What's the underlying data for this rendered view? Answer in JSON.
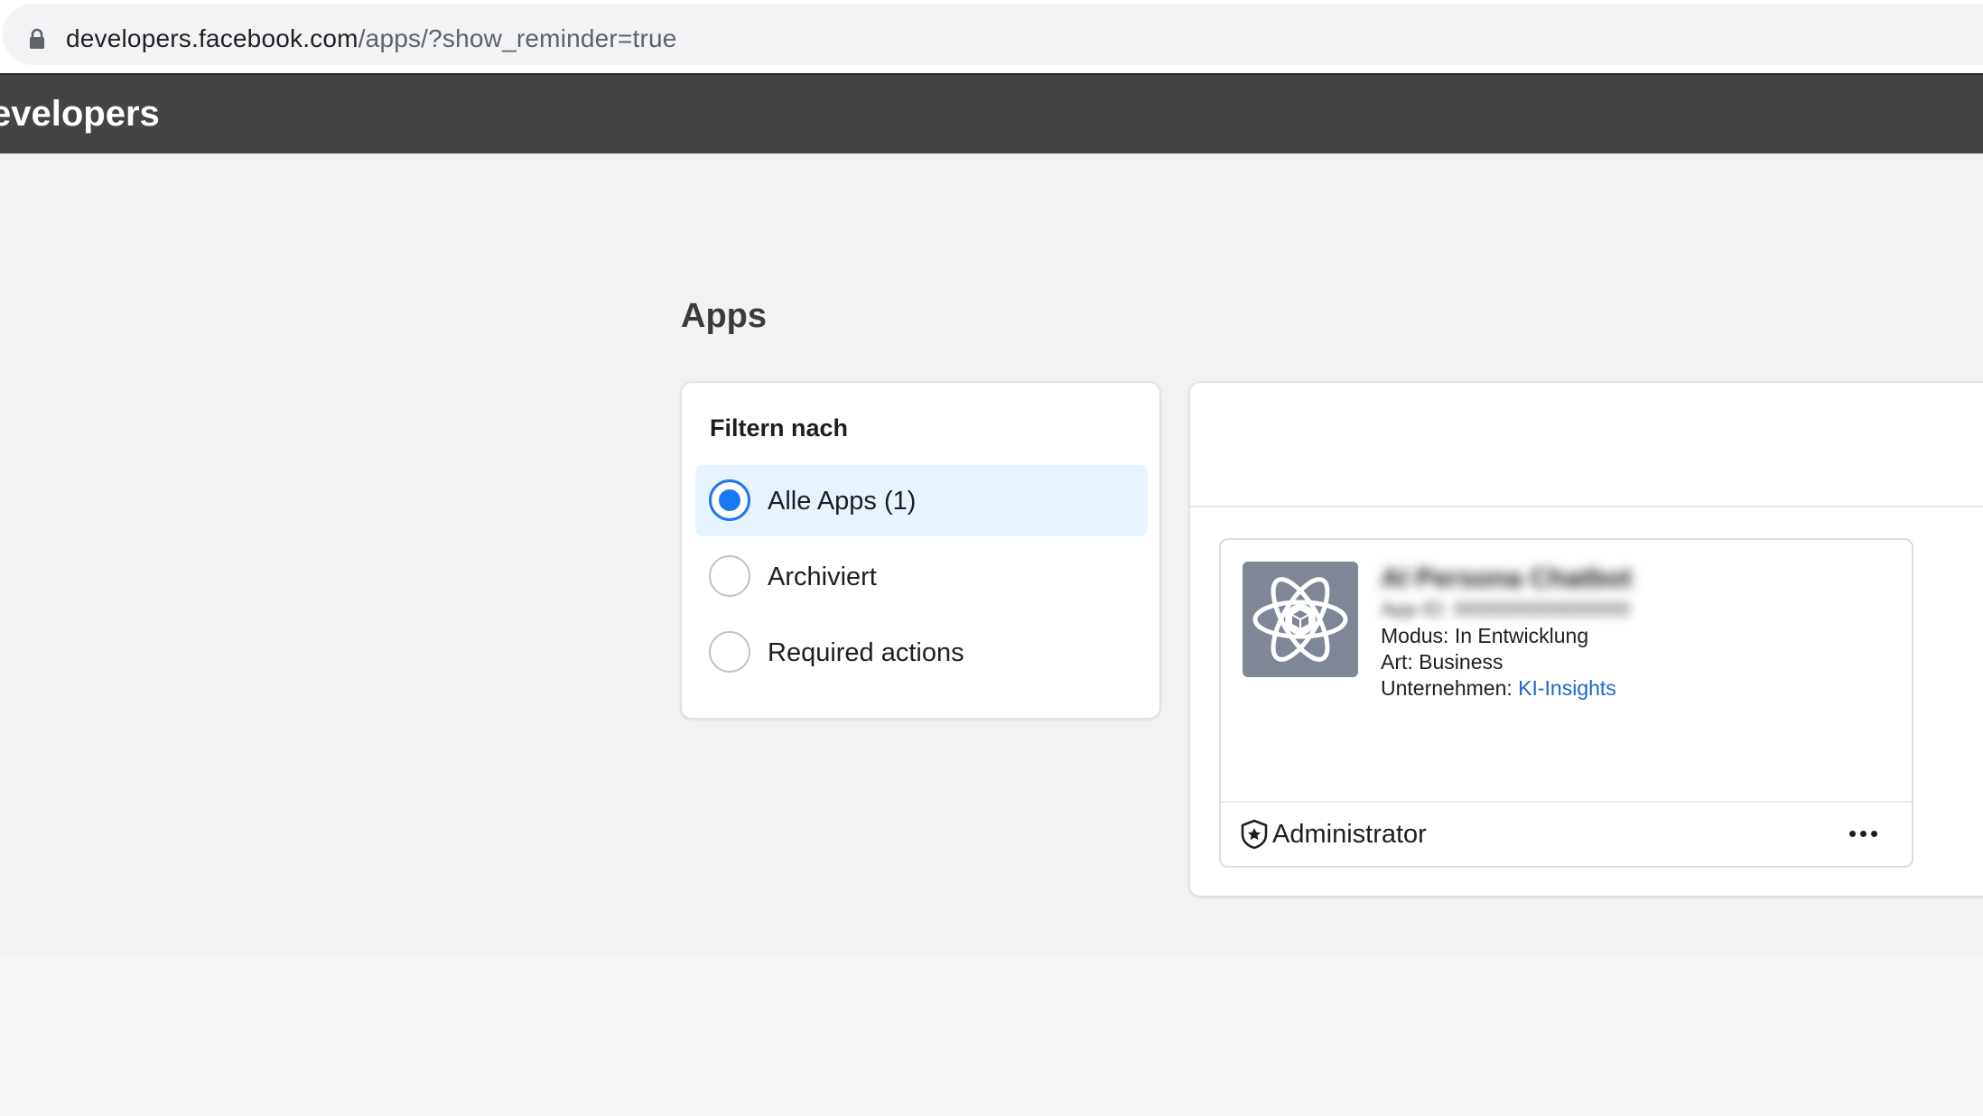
{
  "browser": {
    "url_host": "developers.facebook.com",
    "url_path": "/apps/?show_reminder=true",
    "lock_icon": "lock-icon"
  },
  "header": {
    "brand": "evelopers"
  },
  "page": {
    "title": "Apps"
  },
  "filter": {
    "heading": "Filtern nach",
    "options": [
      {
        "label": "Alle Apps (1)",
        "selected": true
      },
      {
        "label": "Archiviert",
        "selected": false
      },
      {
        "label": "Required actions",
        "selected": false
      }
    ]
  },
  "app_card": {
    "icon": "atom-cube-icon",
    "name": "AI Persona Chatbot",
    "id_line": "App-ID: 0000000000000000",
    "mode_label": "Modus: ",
    "mode_value": "In Entwicklung",
    "type_label": "Art: ",
    "type_value": "Business",
    "company_label": "Unternehmen: ",
    "company_value": "KI-Insights",
    "role": "Administrator",
    "role_icon": "shield-star-icon",
    "more_icon": "more-dots-icon"
  },
  "colors": {
    "accent": "#1877f2",
    "link": "#1a66d2",
    "header_bg": "#444444",
    "selected_bg": "#e7f3ff",
    "icon_bg": "#7f8696"
  }
}
